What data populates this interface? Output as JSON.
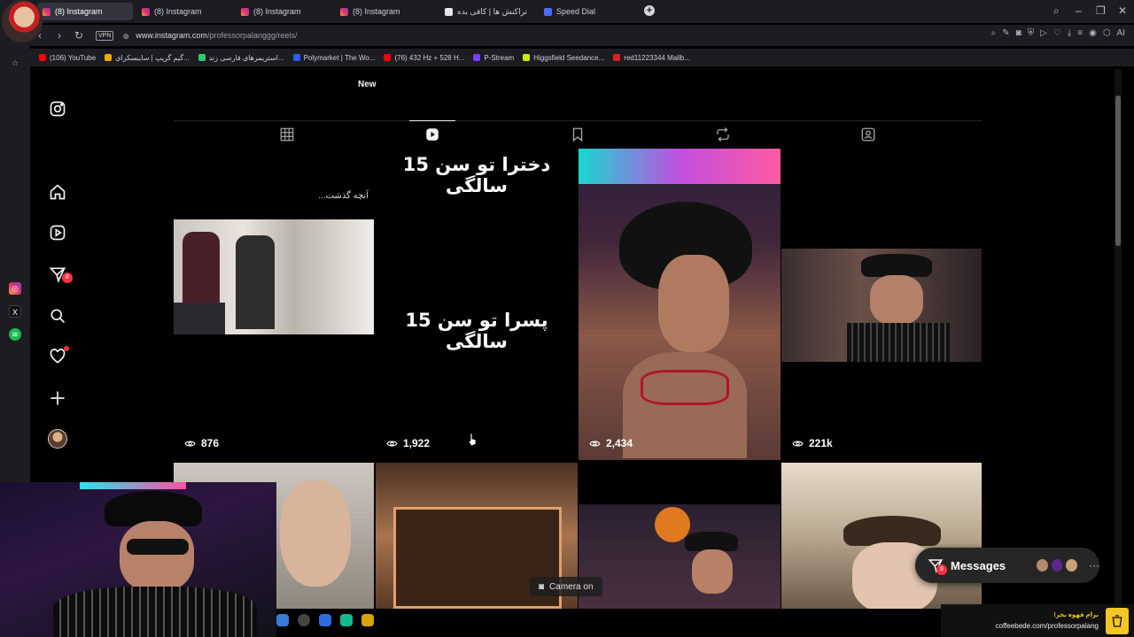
{
  "browser": {
    "tabs": [
      {
        "label": "(8) Instagram",
        "active": true
      },
      {
        "label": "(8) Instagram",
        "active": false
      },
      {
        "label": "(8) Instagram",
        "active": false
      },
      {
        "label": "(8) Instagram",
        "active": false
      },
      {
        "label": "تراکنش ها | کافی بده",
        "active": false
      },
      {
        "label": "Speed Dial",
        "active": false
      }
    ],
    "new_tab": "+",
    "vpn_label": "VPN",
    "url_host": "www.instagram.com",
    "url_path": "/professorpalanggg/reels/",
    "bookmarks": [
      {
        "label": "(106) YouTube",
        "color": "#ff0000"
      },
      {
        "label": "گیم گریپ | سایبسکرای...",
        "color": "#f2a900"
      },
      {
        "label": "استریمرهای فارسی زند...",
        "color": "#2ecc71"
      },
      {
        "label": "Polymarket | The Wo...",
        "color": "#2d5bff"
      },
      {
        "label": "(76) 432 Hz + 528 H...",
        "color": "#ff0000"
      },
      {
        "label": "P-Stream",
        "color": "#7a3cff"
      },
      {
        "label": "Higgsfield Seedance...",
        "color": "#c7f000"
      },
      {
        "label": "red11223344 Mailb...",
        "color": "#e02020"
      }
    ],
    "ai_label": "AI"
  },
  "instagram": {
    "highlight_label": "New",
    "sidebar_badge": "8",
    "reels": [
      {
        "views": "876",
        "caption": "آنچه گذشت..."
      },
      {
        "views": "1,922",
        "text_top": "دخترا تو سن 15 سالگی",
        "text_mid": "پسرا تو سن 15 سالگی"
      },
      {
        "views": "2,434"
      },
      {
        "views": "221k"
      }
    ],
    "messages": {
      "label": "Messages",
      "badge": "8"
    },
    "camera_label": "Camera on"
  },
  "overlay": {
    "coffee_fa": "برام قهوه بخر!",
    "coffee_url": "coffeebede.com/professorpalang"
  }
}
